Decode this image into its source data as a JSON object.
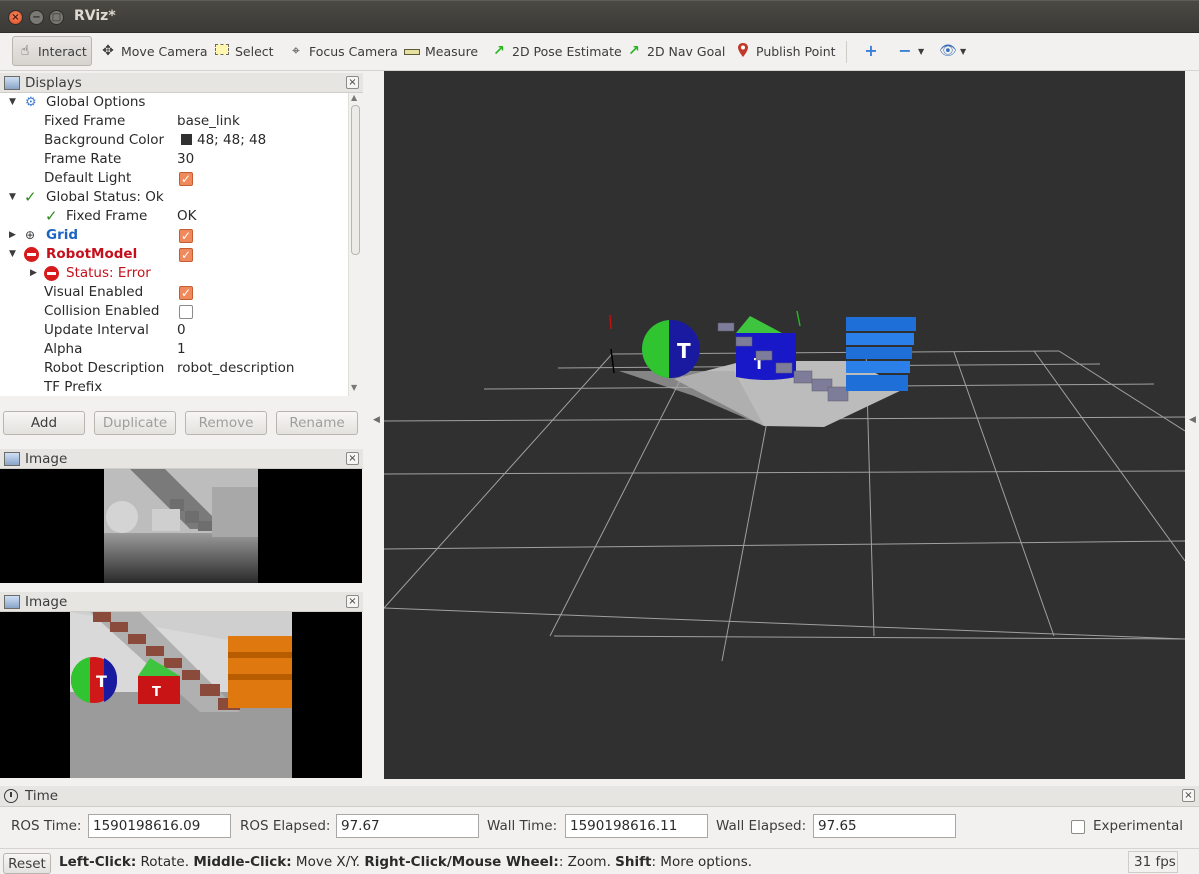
{
  "window": {
    "title": "RViz*"
  },
  "toolbar": {
    "interact": "Interact",
    "move_camera": "Move Camera",
    "select": "Select",
    "focus_camera": "Focus Camera",
    "measure": "Measure",
    "pose_estimate": "2D Pose Estimate",
    "nav_goal": "2D Nav Goal",
    "publish_point": "Publish Point"
  },
  "displays": {
    "title": "Displays",
    "rows": {
      "global_options": "Global Options",
      "fixed_frame_label": "Fixed Frame",
      "fixed_frame_value": "base_link",
      "bg_color_label": "Background Color",
      "bg_color_value": "48; 48; 48",
      "frame_rate_label": "Frame Rate",
      "frame_rate_value": "30",
      "default_light_label": "Default Light",
      "global_status": "Global Status: Ok",
      "gs_fixed_frame_label": "Fixed Frame",
      "gs_fixed_frame_value": "OK",
      "grid": "Grid",
      "robot_model": "RobotModel",
      "status_error": "Status: Error",
      "visual_enabled": "Visual Enabled",
      "collision_enabled": "Collision Enabled",
      "update_interval_label": "Update Interval",
      "update_interval_value": "0",
      "alpha_label": "Alpha",
      "alpha_value": "1",
      "robot_description_label": "Robot Description",
      "robot_description_value": "robot_description",
      "tf_prefix_label": "TF Prefix"
    },
    "buttons": {
      "add": "Add",
      "duplicate": "Duplicate",
      "remove": "Remove",
      "rename": "Rename"
    }
  },
  "image_panels": {
    "depth_title": "Image",
    "rgb_title": "Image"
  },
  "time": {
    "title": "Time",
    "ros_time_label": "ROS Time:",
    "ros_time_value": "1590198616.09",
    "ros_elapsed_label": "ROS Elapsed:",
    "ros_elapsed_value": "97.67",
    "wall_time_label": "Wall Time:",
    "wall_time_value": "1590198616.11",
    "wall_elapsed_label": "Wall Elapsed:",
    "wall_elapsed_value": "97.65",
    "experimental_label": "Experimental"
  },
  "status": {
    "reset": "Reset",
    "left_click": "Left-Click:",
    "left_click_action": " Rotate. ",
    "middle_click": "Middle-Click:",
    "middle_click_action": " Move X/Y. ",
    "right_click": "Right-Click/Mouse Wheel:",
    "right_click_action": ": Zoom. ",
    "shift": "Shift",
    "shift_action": ": More options.",
    "fps": "31 fps"
  },
  "colors": {
    "viewport_bg": "#303030",
    "checkbox_on": "#f08a5d",
    "error_red": "#c5101c",
    "grid_blue": "#1d63c2",
    "ok_green": "#2f8b1e"
  },
  "icons": {
    "interact": "hand-pointer-icon",
    "move_camera": "move-camera-icon",
    "select": "select-rectangle-icon",
    "focus_camera": "focus-crosshair-icon",
    "measure": "ruler-icon",
    "pose_estimate": "green-arrow-icon",
    "nav_goal": "green-arrow-icon",
    "publish_point": "map-pin-icon",
    "add_tool": "plus-icon",
    "remove_tool": "minus-icon",
    "views": "eye-icon"
  }
}
